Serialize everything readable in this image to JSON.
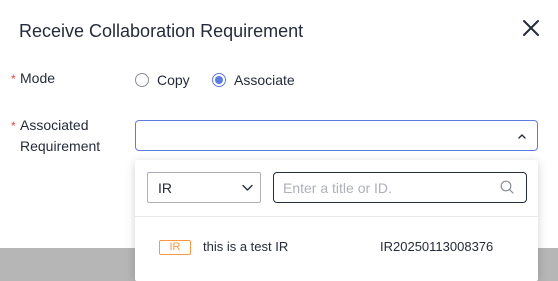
{
  "dialog": {
    "title": "Receive Collaboration Requirement",
    "close_icon": "close-icon"
  },
  "form": {
    "mode": {
      "required_mark": "*",
      "label": "Mode",
      "options": [
        "Copy",
        "Associate"
      ],
      "selected": "Associate"
    },
    "associated_requirement": {
      "required_mark": "*",
      "label_line1": "Associated",
      "label_line2": "Requirement",
      "value": "",
      "chevron_icon": "chevron-up-icon"
    }
  },
  "dropdown": {
    "type_select": {
      "value": "IR",
      "chevron_icon": "chevron-down-icon"
    },
    "search": {
      "placeholder": "Enter a title or ID.",
      "value": "",
      "icon": "search-icon"
    },
    "results": [
      {
        "type": "IR",
        "title": "this is a test IR",
        "id": "IR20250113008376"
      }
    ]
  },
  "colors": {
    "accent": "#5e7ce0",
    "required": "#e54545",
    "badge": "#fa9841",
    "text": "#252b3a",
    "backdrop": "#b6b6b6"
  }
}
